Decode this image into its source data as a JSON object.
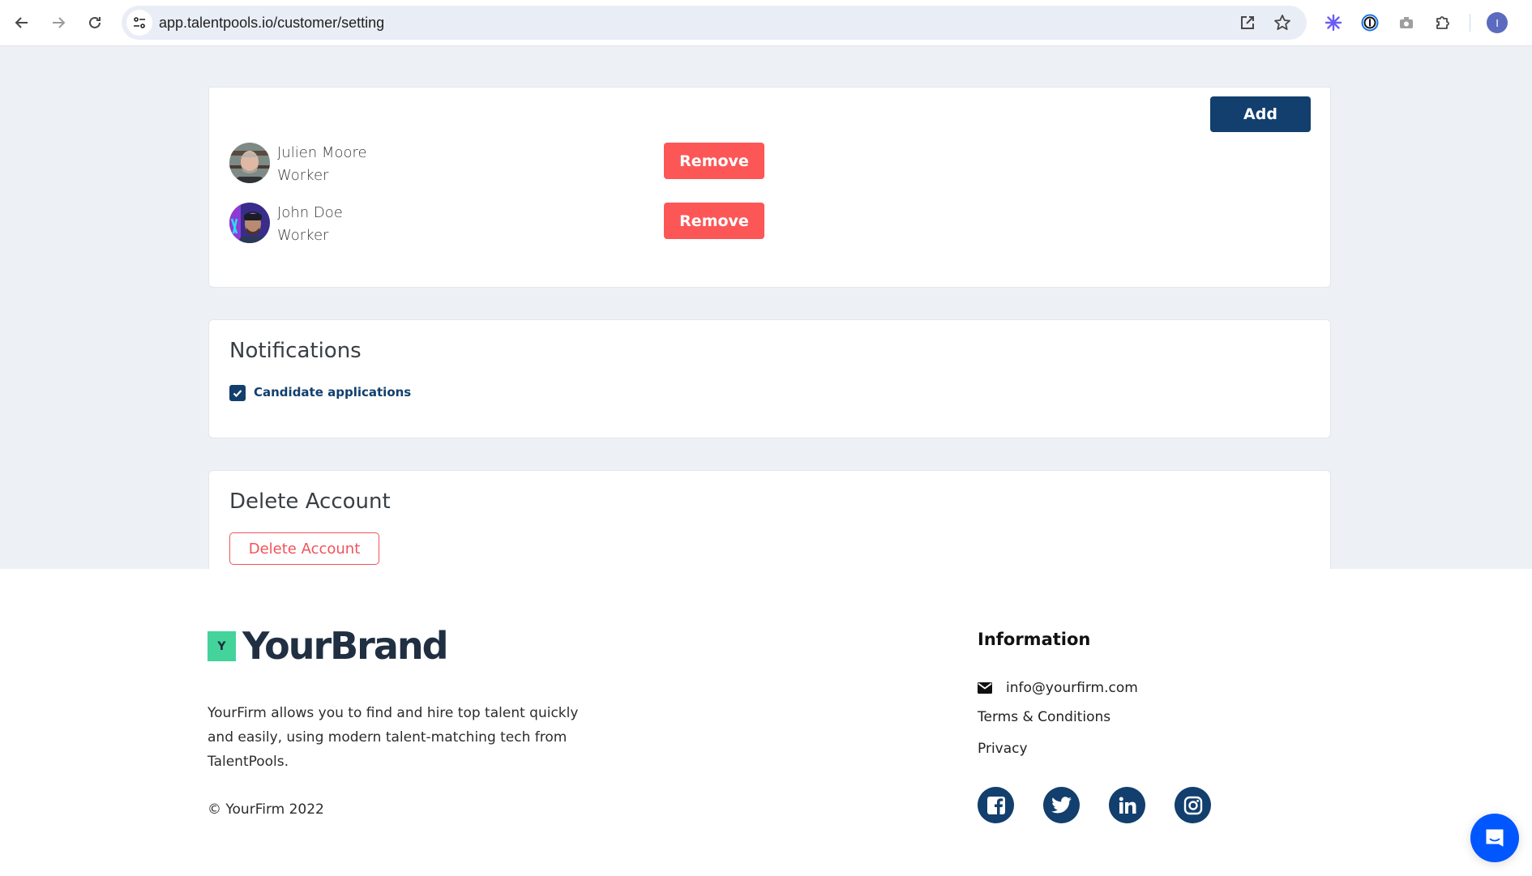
{
  "browser": {
    "url": "app.talentpools.io/customer/setting",
    "profile_initial": "I",
    "extensions": [
      "perplexity-icon",
      "1password-icon",
      "camera-icon",
      "extensions-puzzle-icon"
    ]
  },
  "members_card": {
    "add_label": "Add",
    "members": [
      {
        "name": "Julien Moore",
        "role": "Worker",
        "remove_label": "Remove"
      },
      {
        "name": "John Doe",
        "role": "Worker",
        "remove_label": "Remove"
      }
    ]
  },
  "notifications": {
    "title": "Notifications",
    "options": [
      {
        "label": "Candidate applications",
        "checked": true
      }
    ]
  },
  "delete_account": {
    "title": "Delete Account",
    "button_label": "Delete Account"
  },
  "footer": {
    "logo_mark": "Y",
    "brand": "YourBrand",
    "description": "YourFirm allows you to find and hire top talent quickly and easily, using modern talent-matching tech from TalentPools.",
    "copyright": "© YourFirm 2022",
    "information": {
      "title": "Information",
      "email": "info@yourfirm.com",
      "terms": "Terms & Conditions",
      "privacy": "Privacy"
    },
    "social": [
      "facebook",
      "twitter",
      "linkedin",
      "instagram"
    ]
  },
  "colors": {
    "primary": "#123f6d",
    "danger": "#fd5656",
    "brand_green": "#43d39b",
    "page_bg": "#edf1f5",
    "chat": "#0057ff"
  }
}
